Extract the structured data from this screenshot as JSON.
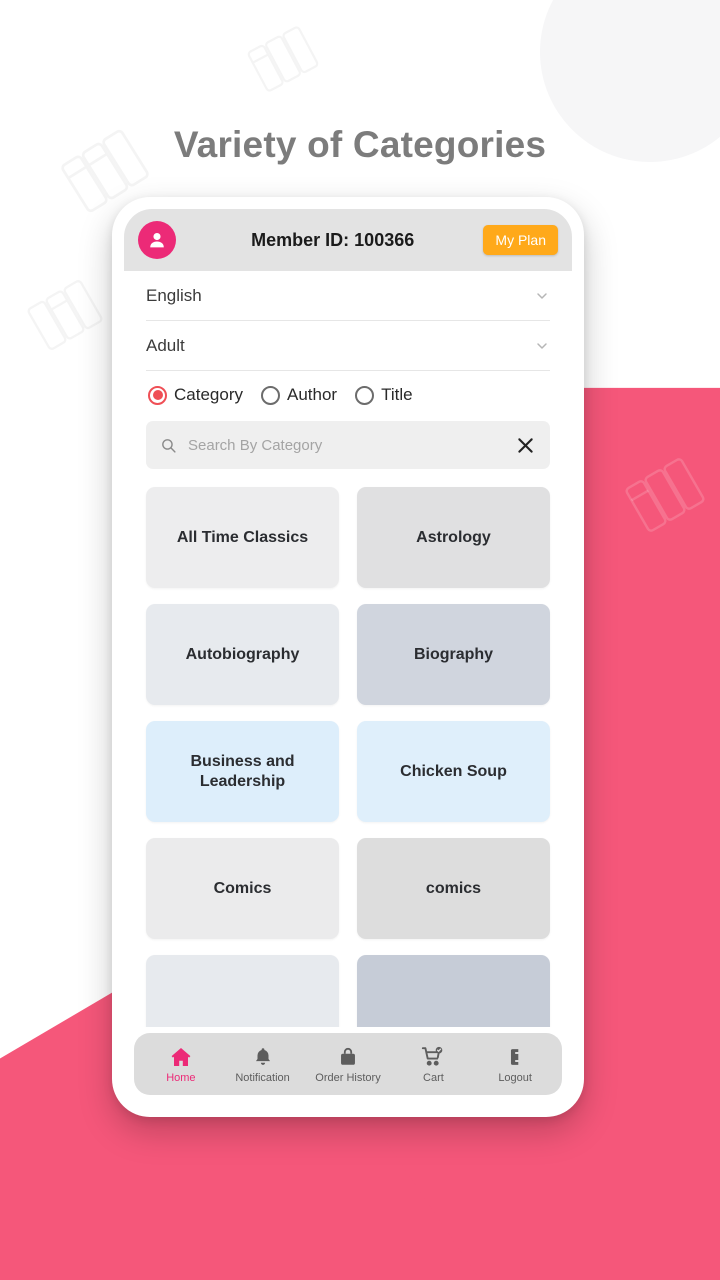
{
  "page": {
    "title": "Variety of Categories",
    "background_color": "#ffffff",
    "accent_pink": "#f5577a"
  },
  "phone": {
    "header": {
      "avatar_icon": "user-avatar-icon",
      "member_id": "Member ID: 100366",
      "my_plan_label": "My Plan",
      "my_plan_color": "#ffa91a",
      "avatar_color": "#ec2a77"
    },
    "filters": {
      "language": {
        "value": "English",
        "chevron": "chevron-down-icon"
      },
      "audience": {
        "value": "Adult",
        "chevron": "chevron-down-icon"
      },
      "search_by": {
        "options": [
          {
            "label": "Category",
            "selected": true
          },
          {
            "label": "Author",
            "selected": false
          },
          {
            "label": "Title",
            "selected": false
          }
        ],
        "selected_color": "#ef4f56"
      }
    },
    "search": {
      "placeholder": "Search By Category",
      "value": "",
      "search_icon": "search-icon",
      "clear_icon": "close-icon"
    },
    "categories": [
      {
        "label": "All Time Classics",
        "color": "#ededee"
      },
      {
        "label": "Astrology",
        "color": "#e0e0e1"
      },
      {
        "label": "Autobiography",
        "color": "#e7eaee"
      },
      {
        "label": "Biography",
        "color": "#d0d5de"
      },
      {
        "label": "Business and Leadership",
        "color": "#ddeefb"
      },
      {
        "label": "Chicken Soup",
        "color": "#dfeffb"
      },
      {
        "label": "Comics",
        "color": "#ebebec"
      },
      {
        "label": "comics",
        "color": "#dddddd"
      },
      {
        "label": "",
        "color": "#e7eaee"
      },
      {
        "label": "",
        "color": "#c6ccd7"
      }
    ],
    "bottom_nav": [
      {
        "label": "Home",
        "icon": "home-icon",
        "active": true
      },
      {
        "label": "Notification",
        "icon": "bell-icon",
        "active": false
      },
      {
        "label": "Order History",
        "icon": "shopping-bag-icon",
        "active": false
      },
      {
        "label": "Cart",
        "icon": "cart-check-icon",
        "active": false
      },
      {
        "label": "Logout",
        "icon": "logout-icon",
        "active": false
      }
    ]
  }
}
